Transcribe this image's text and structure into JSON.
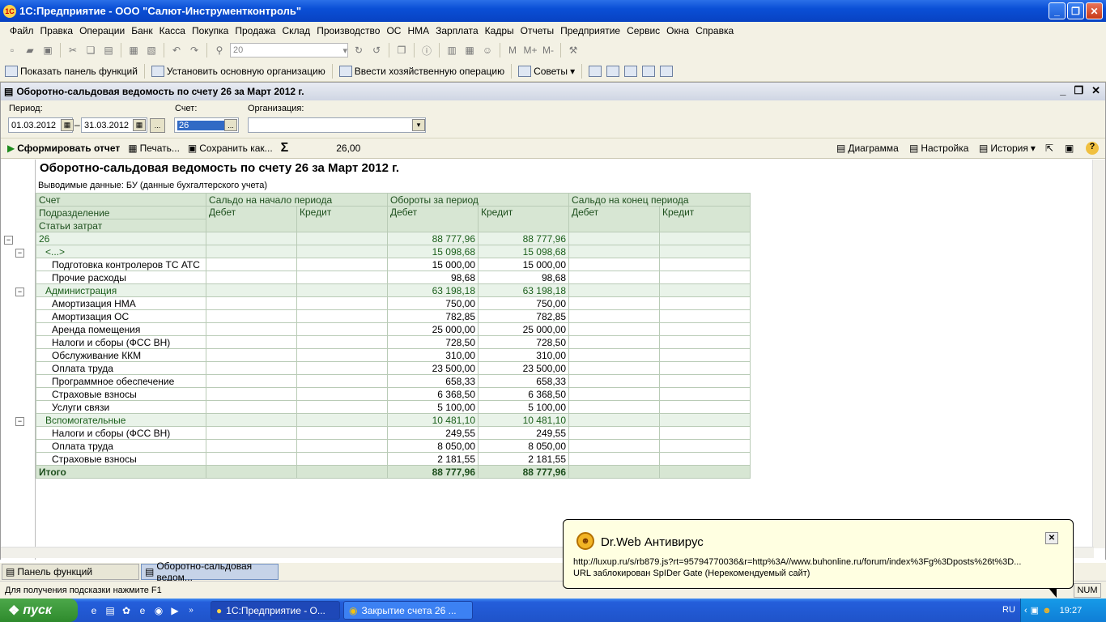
{
  "window": {
    "title": "1С:Предприятие - ООО \"Салют-Инструментконтроль\"",
    "logo": "1С"
  },
  "menu": [
    "Файл",
    "Правка",
    "Операции",
    "Банк",
    "Касса",
    "Покупка",
    "Продажа",
    "Склад",
    "Производство",
    "ОС",
    "НМА",
    "Зарплата",
    "Кадры",
    "Отчеты",
    "Предприятие",
    "Сервис",
    "Окна",
    "Справка"
  ],
  "toolbar1": {
    "zoom": "20"
  },
  "toolbar2": {
    "show_panel": "Показать панель функций",
    "set_org": "Установить основную организацию",
    "enter_op": "Ввести хозяйственную операцию",
    "tips": "Советы"
  },
  "doc": {
    "title": "Оборотно-сальдовая ведомость по счету 26 за Март 2012 г.",
    "period_label": "Период:",
    "date_from": "01.03.2012",
    "date_to": "31.03.2012",
    "account_label": "Счет:",
    "account": "26",
    "org_label": "Организация:",
    "org": "",
    "generate": "Сформировать отчет",
    "print": "Печать...",
    "save": "Сохранить как...",
    "sum": "26,00",
    "diagram": "Диаграмма",
    "settings": "Настройка",
    "history": "История"
  },
  "report": {
    "title": "Оборотно-сальдовая ведомость по счету 26 за Март 2012 г.",
    "subtitle": "Выводимые данные:  БУ (данные бухгалтерского учета)",
    "headers": {
      "account": "Счет",
      "sub": "Подразделение",
      "cost": "Статьи затрат",
      "open": "Сальдо на начало периода",
      "turn": "Обороты за период",
      "close": "Сальдо на конец периода",
      "debit": "Дебет",
      "credit": "Кредит"
    },
    "rows": [
      {
        "name": "26",
        "d": "88 777,96",
        "c": "88 777,96",
        "type": "top"
      },
      {
        "name": "<...>",
        "d": "15 098,68",
        "c": "15 098,68",
        "type": "grp"
      },
      {
        "name": "Подготовка контролеров ТС АТС",
        "d": "15 000,00",
        "c": "15 000,00",
        "type": "row"
      },
      {
        "name": "Прочие расходы",
        "d": "98,68",
        "c": "98,68",
        "type": "row"
      },
      {
        "name": "Администрация",
        "d": "63 198,18",
        "c": "63 198,18",
        "type": "grp"
      },
      {
        "name": "Амортизация НМА",
        "d": "750,00",
        "c": "750,00",
        "type": "row"
      },
      {
        "name": "Амортизация ОС",
        "d": "782,85",
        "c": "782,85",
        "type": "row"
      },
      {
        "name": "Аренда помещения",
        "d": "25 000,00",
        "c": "25 000,00",
        "type": "row"
      },
      {
        "name": "Налоги и сборы (ФСС ВН)",
        "d": "728,50",
        "c": "728,50",
        "type": "row"
      },
      {
        "name": "Обслуживание ККМ",
        "d": "310,00",
        "c": "310,00",
        "type": "row"
      },
      {
        "name": "Оплата труда",
        "d": "23 500,00",
        "c": "23 500,00",
        "type": "row"
      },
      {
        "name": "Программное обеспечение",
        "d": "658,33",
        "c": "658,33",
        "type": "row"
      },
      {
        "name": "Страховые взносы",
        "d": "6 368,50",
        "c": "6 368,50",
        "type": "row"
      },
      {
        "name": "Услуги связи",
        "d": "5 100,00",
        "c": "5 100,00",
        "type": "row"
      },
      {
        "name": "Вспомогательные",
        "d": "10 481,10",
        "c": "10 481,10",
        "type": "grp"
      },
      {
        "name": "Налоги и сборы (ФСС ВН)",
        "d": "249,55",
        "c": "249,55",
        "type": "row"
      },
      {
        "name": "Оплата труда",
        "d": "8 050,00",
        "c": "8 050,00",
        "type": "row"
      },
      {
        "name": "Страховые взносы",
        "d": "2 181,55",
        "c": "2 181,55",
        "type": "row"
      },
      {
        "name": "Итого",
        "d": "88 777,96",
        "c": "88 777,96",
        "type": "tot"
      }
    ]
  },
  "tabs": [
    "Панель функций",
    "Оборотно-сальдовая ведом..."
  ],
  "status": {
    "hint": "Для получения подсказки нажмите F1",
    "num": "NUM"
  },
  "taskbar": {
    "start": "пуск",
    "tasks": [
      "1С:Предприятие - О...",
      "Закрытие счета 26 ..."
    ],
    "lang": "RU",
    "time": "19:27"
  },
  "popup": {
    "title": "Dr.Web Антивирус",
    "url": "http://luxup.ru/s/rb879.js?rt=95794770036&r=http%3A//www.buhonline.ru/forum/index%3Fg%3Dposts%26t%3D...",
    "msg": "URL заблокирован SpIDer Gate (Нерекомендуемый сайт)"
  }
}
